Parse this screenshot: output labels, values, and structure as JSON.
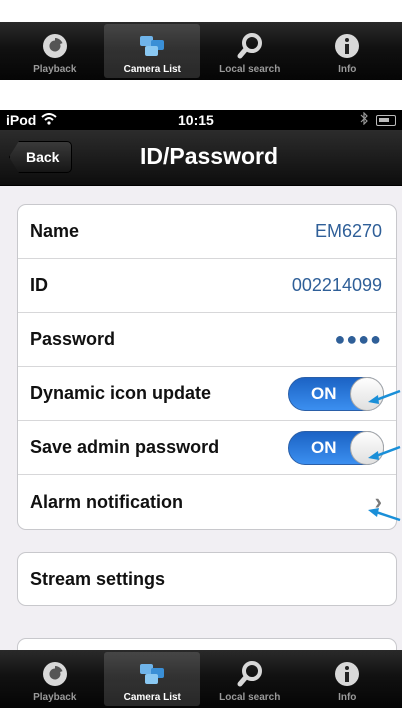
{
  "tabs": [
    {
      "label": "Playback",
      "icon": "playback-icon",
      "active": false
    },
    {
      "label": "Camera List",
      "icon": "camera-list-icon",
      "active": true
    },
    {
      "label": "Local search",
      "icon": "search-icon",
      "active": false
    },
    {
      "label": "Info",
      "icon": "info-icon",
      "active": false
    }
  ],
  "status": {
    "carrier": "iPod",
    "time": "10:15"
  },
  "nav": {
    "back_label": "Back",
    "title": "ID/Password"
  },
  "settings": {
    "name_label": "Name",
    "name_value": "EM6270",
    "id_label": "ID",
    "id_value": "002214099",
    "password_label": "Password",
    "password_value": "●●●●",
    "dynamic_label": "Dynamic icon update",
    "dynamic_state": "ON",
    "save_admin_label": "Save admin password",
    "save_admin_state": "ON",
    "alarm_label": "Alarm notification",
    "stream_label": "Stream settings"
  },
  "colors": {
    "value_text": "#2f5f98",
    "toggle_on": "#2f7ee0",
    "arrow_accent": "#1a8fd8"
  }
}
